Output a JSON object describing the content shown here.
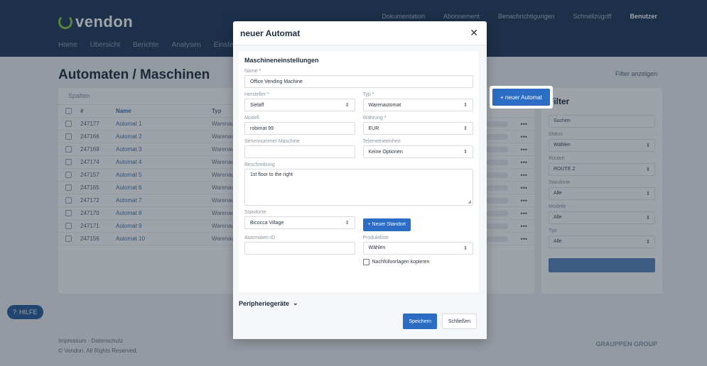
{
  "app": {
    "logo_text": "vendon",
    "nav": [
      "Home",
      "Übersicht",
      "Berichte",
      "Analysen",
      "Einstellungen"
    ],
    "top_right": {
      "item1": "Dokumentation",
      "item2": "Abonnement",
      "item3": "Benachrichtigungen",
      "item4": "Schnellzugriff",
      "user": "Benutzer"
    },
    "page_title": "Automaten / Maschinen",
    "filter_link": "Filter anzeigen",
    "table_toolbar": "Spalten",
    "table_headers": [
      "#",
      "Name",
      "Typ"
    ],
    "rows": [
      {
        "id": "247177",
        "name": "Automat 1",
        "type": "Warenaut."
      },
      {
        "id": "247166",
        "name": "Automat 2",
        "type": "Warenaut."
      },
      {
        "id": "247169",
        "name": "Automat 3",
        "type": "Warenaut."
      },
      {
        "id": "247174",
        "name": "Automat 4",
        "type": "Warenaut."
      },
      {
        "id": "247157",
        "name": "Automat 5",
        "type": "Warenaut."
      },
      {
        "id": "247165",
        "name": "Automat 6",
        "type": "Warenaut."
      },
      {
        "id": "247172",
        "name": "Automat 7",
        "type": "Warenaut."
      },
      {
        "id": "247170",
        "name": "Automat 8",
        "type": "Warenaut."
      },
      {
        "id": "247171",
        "name": "Automat 9",
        "type": "Warenaut."
      },
      {
        "id": "247156",
        "name": "Automat 10",
        "type": "Warenaut."
      }
    ],
    "side_title": "Filter",
    "side_search": "Suchen",
    "side_filters": [
      {
        "label": "Status",
        "value": "Wählen"
      },
      {
        "label": "Routen",
        "value": "ROUTE 2"
      },
      {
        "label": "Standorte",
        "value": "Alle"
      },
      {
        "label": "Modelle",
        "value": "Alle"
      },
      {
        "label": "Typ",
        "value": "Alle"
      }
    ],
    "help_label": "HILFE",
    "footer_line1": "Impressum · Datenschutz",
    "footer_line2": "© Vendon. All Rights Reserved.",
    "footer_brand": "GRAUPPEN GROUP"
  },
  "new_machine_button": "+ neuer Automat",
  "modal": {
    "title": "neuer Automat",
    "section_title": "Maschineneinstellungen",
    "name_label": "Name *",
    "name_value": "Office Vending Machine",
    "manufacturer_label": "Hersteller *",
    "manufacturer_value": "Sielaff",
    "type_label": "Typ *",
    "type_value": "Warenautomat",
    "model_label": "Modell",
    "model_value": "robimat 99",
    "currency_label": "Währung *",
    "currency_value": "EUR",
    "serial_label": "Seriennummer Maschine",
    "serial_value": "",
    "telemetry_label": "Telemetrieeinheit",
    "telemetry_value": "Keine Optionen",
    "description_label": "Beschreibung",
    "description_value": "1st floor to the right",
    "location_label": "Standorte",
    "location_value": "Bicocca Village",
    "new_location_button": "+ Neuer Standort",
    "machine_id_label": "Automaten-ID",
    "machine_id_value": "",
    "product_list_label": "Produktliste",
    "product_list_value": "Wählen",
    "copy_templates_label": "Nachfüllvorlagen kopieren",
    "peripherals_label": "Peripheriegeräte",
    "save_button": "Speichern",
    "close_button": "Schließen"
  }
}
